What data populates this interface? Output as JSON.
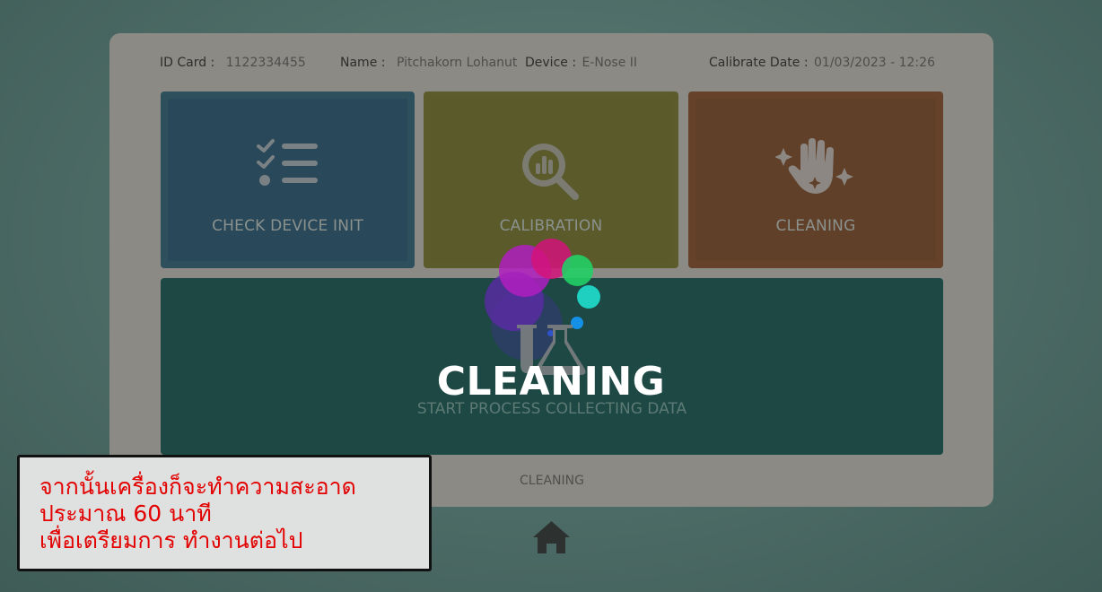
{
  "header": {
    "id_card_label": "ID Card :",
    "id_card_value": "1122334455",
    "name_label": "Name :",
    "name_value": "Pitchakorn Lohanut",
    "device_label": "Device :",
    "device_value": "E-Nose II",
    "calibrate_label": "Calibrate Date :",
    "calibrate_value": "01/03/2023 - 12:26"
  },
  "tiles": {
    "check": {
      "label": "CHECK DEVICE INIT",
      "icon": "checklist-icon"
    },
    "calibration": {
      "label": "CALIBRATION",
      "icon": "magnifier-chart-icon"
    },
    "cleaning": {
      "label": "CLEANING",
      "icon": "sparkle-hand-icon"
    },
    "start": {
      "label": "START PROCESS COLLECTING DATA",
      "icon": "lab-flask-icon"
    }
  },
  "overlay": {
    "title": "CLEANING",
    "colors": [
      "#c21fc7",
      "#e0147b",
      "#21d66b",
      "#1fd3c4",
      "#1590e8",
      "#6b2bc9"
    ]
  },
  "status": {
    "text": "CLEANING"
  },
  "nav": {
    "home_icon": "home-icon"
  },
  "note": {
    "line1": "จากนั้นเครื่องก็จะทำความสะอาด",
    "line2": "ประมาณ 60 นาที",
    "line3": "เพื่อเตรียมการ ทำงานต่อไป"
  }
}
